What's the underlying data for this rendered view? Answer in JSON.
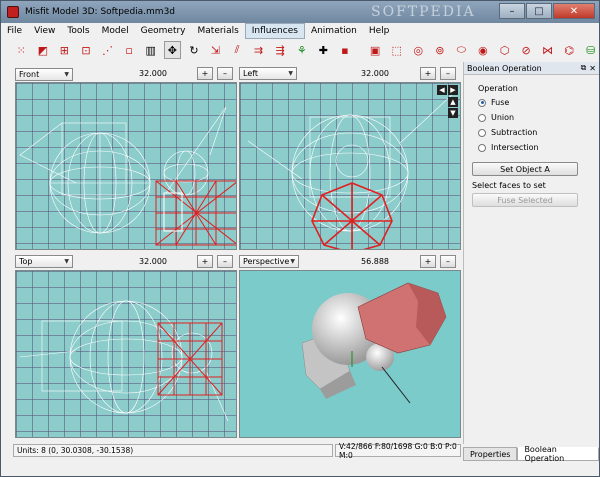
{
  "window": {
    "title": "Misfit Model 3D: Softpedia.mm3d",
    "watermark": "SOFTPEDIA",
    "controls": {
      "minimize": "–",
      "maximize": "□",
      "close": "✕"
    }
  },
  "menu": [
    "File",
    "View",
    "Tools",
    "Model",
    "Geometry",
    "Materials",
    "Influences",
    "Animation",
    "Help"
  ],
  "toolbar_icons": [
    "select-vertices-icon",
    "select-faces-icon",
    "select-connected-icon",
    "select-groups-icon",
    "select-bones-icon",
    "select-points-icon",
    "select-projections-icon",
    "move-icon",
    "rotate-icon",
    "scale-icon",
    "shear-icon",
    "extrude-icon",
    "attract-near-icon",
    "bone-joint-icon",
    "point-icon",
    "vertex-icon",
    "rect-icon",
    "cube-icon",
    "ellipse-icon",
    "torus-icon",
    "cylinder-icon",
    "sphere-icon",
    "polygon-icon",
    "projection-icon",
    "face-icon",
    "torus-red-icon",
    "cylinder-colored-icon"
  ],
  "viewports": {
    "front": {
      "view": "Front",
      "zoom": "32.000"
    },
    "left": {
      "view": "Left",
      "zoom": "32.000"
    },
    "top": {
      "view": "Top",
      "zoom": "32.000"
    },
    "perspective": {
      "view": "Perspective",
      "zoom": "56.888"
    }
  },
  "zoom_in_icon": "+",
  "zoom_out_icon": "–",
  "nav_arrows": [
    "◀",
    "▶",
    "▲",
    "▼"
  ],
  "panel": {
    "title": "Boolean Operation",
    "operation_label": "Operation",
    "options": [
      "Fuse",
      "Union",
      "Subtraction",
      "Intersection"
    ],
    "selected": "Fuse",
    "set_object_button": "Set Object A",
    "hint": "Select faces to set",
    "action_button": "Fuse Selected",
    "float_icon": "⧉",
    "close_icon": "✕"
  },
  "status": {
    "units": "Units: 8  (0, 30.0308, -30.1538)",
    "counts": "V:42/866  F:80/1698  G:0  B:0  P:0  M:0"
  },
  "tabs": [
    "Properties",
    "Boolean Operation"
  ],
  "active_tab": "Boolean Operation",
  "colors": {
    "viewport_bg": "#8ccccb",
    "grid": "#5a5078",
    "wire": "#ffffff",
    "selected_wire": "#e02020",
    "title_bar": "#7f97af"
  }
}
